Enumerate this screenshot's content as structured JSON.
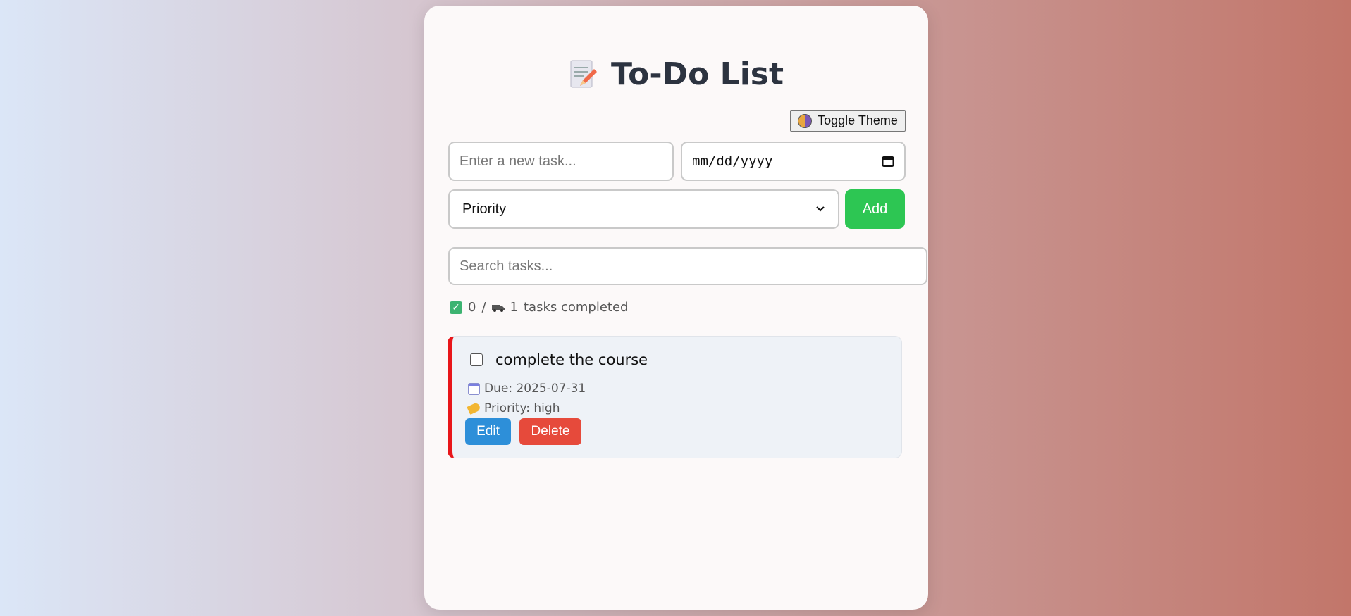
{
  "app": {
    "title": "To-Do List",
    "toggle_label": "Toggle Theme"
  },
  "form": {
    "task_placeholder": "Enter a new task...",
    "date_value": "mm/dd/yyyy",
    "priority_selected": "Priority",
    "add_label": "Add",
    "search_placeholder": "Search tasks..."
  },
  "stats": {
    "completed": "0",
    "separator": "/",
    "total": "1",
    "suffix": "tasks completed"
  },
  "tasks": [
    {
      "name": "complete the course",
      "due": "Due: 2025-07-31",
      "priority": "Priority: high",
      "checked": false,
      "edit_label": "Edit",
      "delete_label": "Delete",
      "priority_color": "#e8161a"
    }
  ],
  "colors": {
    "accent_green": "#2dc653",
    "edit_blue": "#2d8fd9",
    "delete_red": "#e64a3b"
  }
}
